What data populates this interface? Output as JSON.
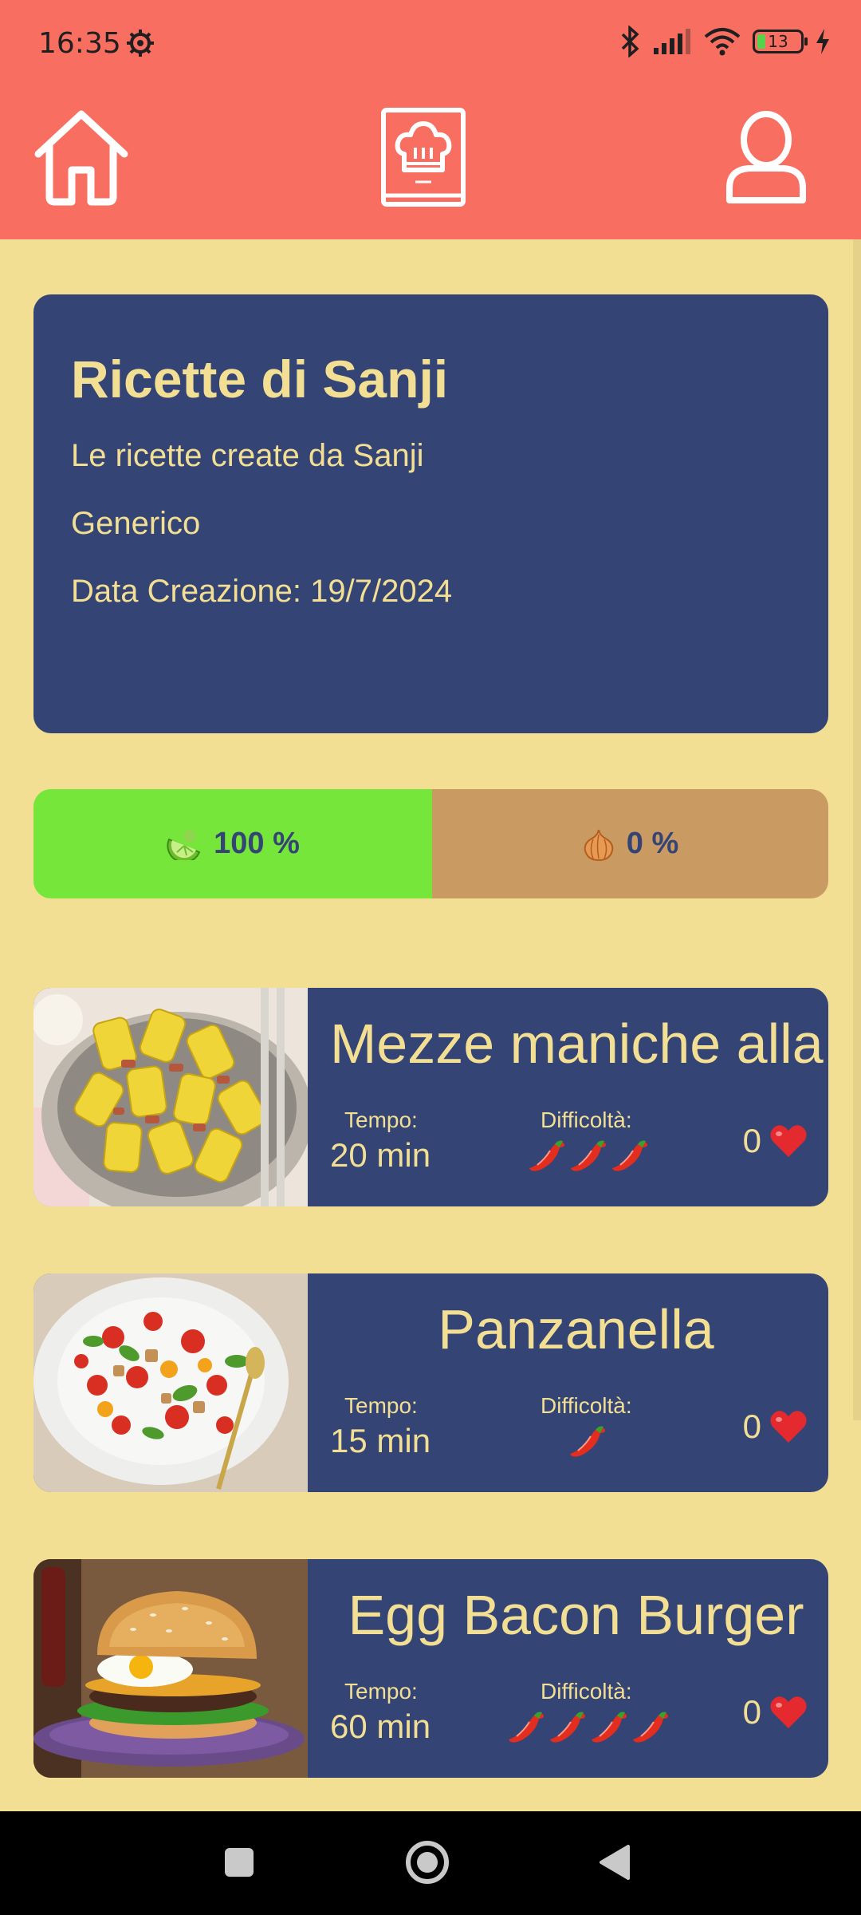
{
  "status_bar": {
    "time": "16:35",
    "battery_level": "13",
    "icons": [
      "gear-icon",
      "bluetooth-icon",
      "signal-icon",
      "wifi-icon",
      "battery-icon",
      "charging-icon"
    ]
  },
  "nav": {
    "items": [
      "home-icon",
      "recipe-book-icon",
      "user-icon"
    ]
  },
  "collection": {
    "title": "Ricette di Sanji",
    "description": "Le ricette create da Sanji",
    "category": "Generico",
    "created": "Data Creazione: 19/7/2024"
  },
  "ratio": {
    "left_label": "100 %",
    "left_value": 100,
    "left_icon": "lime-icon",
    "right_label": "0 %",
    "right_value": 0,
    "right_icon": "onion-icon"
  },
  "recipe_labels": {
    "time": "Tempo:",
    "difficulty": "Difficoltà:"
  },
  "recipes": [
    {
      "title": "Mezze maniche alla",
      "time": "20 min",
      "difficulty": 3,
      "likes": "0",
      "image": "pasta-photo"
    },
    {
      "title": "Panzanella",
      "time": "15 min",
      "difficulty": 1,
      "likes": "0",
      "image": "salad-photo"
    },
    {
      "title": "Egg Bacon Burger",
      "time": "60 min",
      "difficulty": 4,
      "likes": "0",
      "image": "burger-photo"
    }
  ],
  "colors": {
    "header": "#f86e60",
    "background": "#f3df94",
    "card": "#334475",
    "card_text": "#f3df94",
    "green": "#76e73a",
    "brown": "#c99b63"
  }
}
